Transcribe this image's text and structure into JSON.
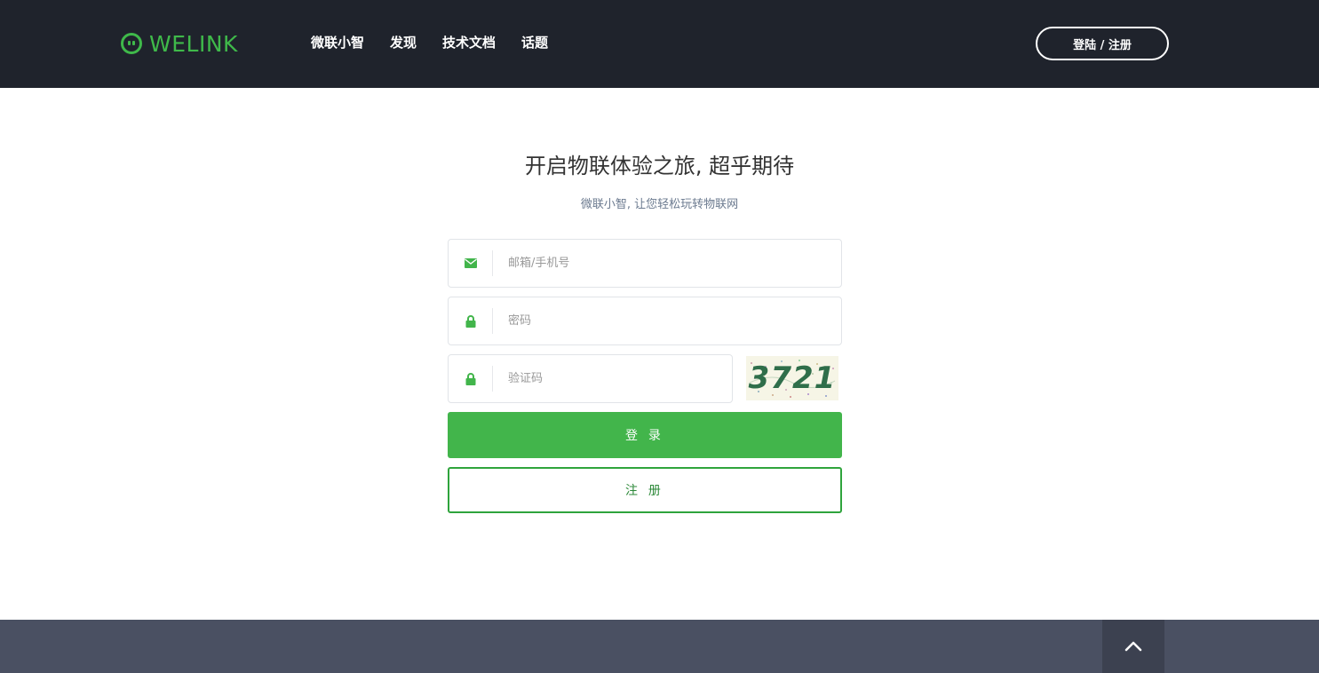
{
  "brand": {
    "name": "WELINK",
    "color": "#3fb94a"
  },
  "nav": {
    "items": [
      {
        "label": "微联小智"
      },
      {
        "label": "发现"
      },
      {
        "label": "技术文档"
      },
      {
        "label": "话题"
      }
    ],
    "login_register": "登陆 / 注册"
  },
  "main": {
    "title": "开启物联体验之旅, 超乎期待",
    "subtitle": "微联小智, 让您轻松玩转物联网",
    "fields": {
      "account": {
        "placeholder": "邮箱/手机号",
        "value": "",
        "icon": "envelope-icon"
      },
      "password": {
        "placeholder": "密码",
        "value": "",
        "icon": "lock-icon"
      },
      "captcha": {
        "placeholder": "验证码",
        "value": "",
        "icon": "lock-icon"
      }
    },
    "captcha_image_text": "3721",
    "login_button": "登 录",
    "register_button": "注 册"
  },
  "footer": {
    "back_to_top_icon": "chevron-up-icon"
  },
  "colors": {
    "accent": "#42b54b",
    "navbar_bg": "#1f232c",
    "footer_bg": "#4a5062"
  }
}
